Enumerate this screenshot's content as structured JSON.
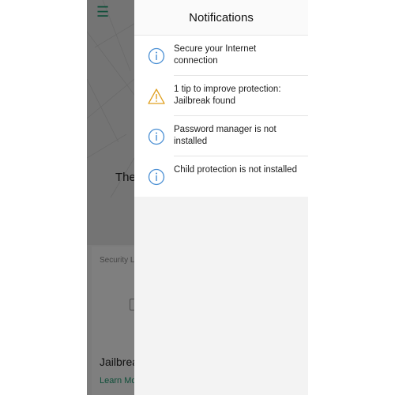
{
  "background": {
    "menu_icon": "hamburger-menu-icon",
    "status_text_partial": "The",
    "card": {
      "label_partial": "Security L",
      "title_partial": "Jailbrea",
      "link_partial": "Learn Mo"
    }
  },
  "notifications": {
    "title": "Notifications",
    "items": [
      {
        "icon": "info-icon",
        "text": "Secure your Internet connection",
        "color": "#4a8fd4"
      },
      {
        "icon": "warning-icon",
        "text": "1 tip to improve protection: Jailbreak found",
        "color": "#e0a020"
      },
      {
        "icon": "info-icon",
        "text": "Password manager is not installed",
        "color": "#4a8fd4"
      },
      {
        "icon": "info-icon",
        "text": "Child protection is not installed",
        "color": "#4a8fd4"
      }
    ]
  },
  "colors": {
    "accent_green": "#1f9d73",
    "info_blue": "#4a8fd4",
    "warning_amber": "#e0a020"
  }
}
